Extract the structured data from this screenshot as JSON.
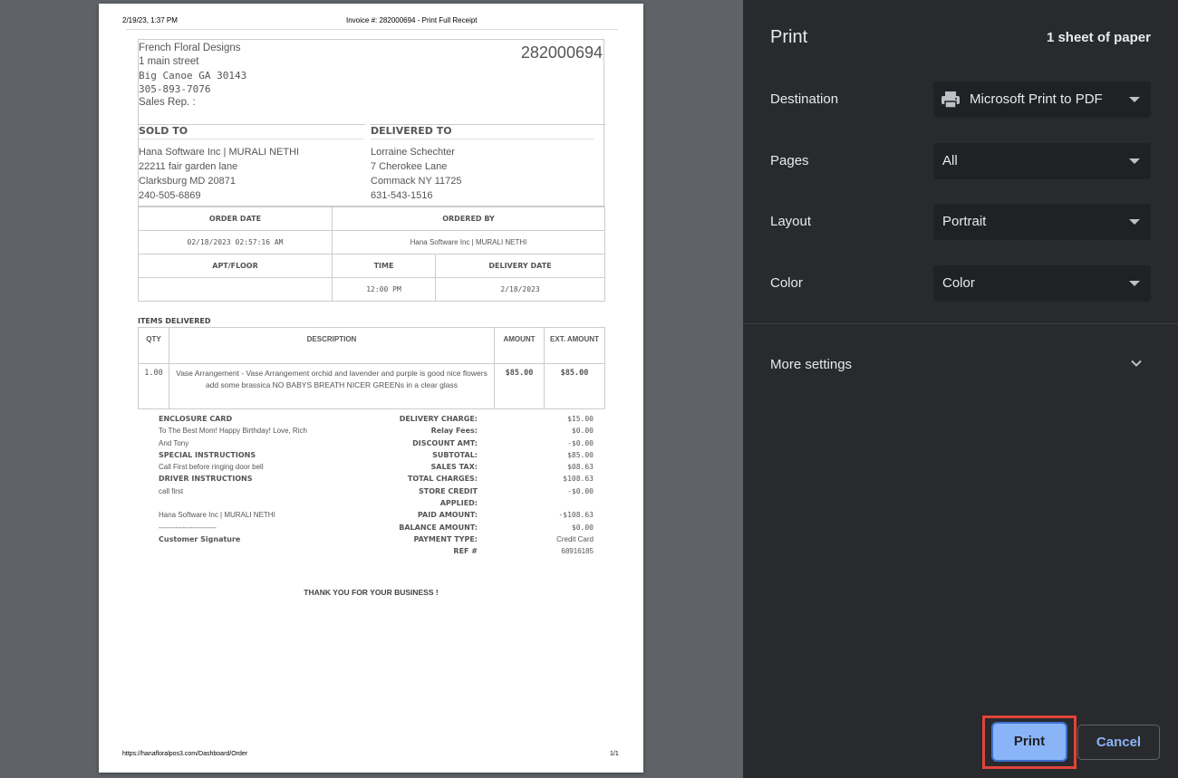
{
  "preview": {
    "header_date": "2/19/23, 1:37 PM",
    "header_title": "Invoice #: 282000694 - Print Full Receipt",
    "footer_url": "https://hanafloralpos3.com/Dashboard/Order",
    "footer_page": "1/1"
  },
  "receipt": {
    "shop_name": "French Floral Designs",
    "shop_street": "1 main street",
    "shop_city": "Big Canoe GA 30143",
    "shop_phone": "305-893-7076",
    "sales_rep": "Sales Rep. :",
    "invoice_number": "282000694",
    "sold_to_label": "SOLD TO",
    "sold_to": [
      "Hana Software Inc | MURALI NETHI",
      "22211 fair garden lane",
      "Clarksburg MD 20871",
      "240-505-6869"
    ],
    "delivered_to_label": "DELIVERED TO",
    "delivered_to": [
      "Lorraine Schechter",
      "7 Cherokee Lane",
      "Commack NY 11725",
      "631-543-1516"
    ],
    "order_date_label": "ORDER DATE",
    "order_date": "02/18/2023 02:57:16 AM",
    "ordered_by_label": "ORDERED BY",
    "ordered_by": "Hana Software Inc | MURALI NETHI",
    "apt_floor_label": "APT/FLOOR",
    "apt_floor": "",
    "time_label": "TIME",
    "time": "12:00 PM",
    "delivery_date_label": "DELIVERY DATE",
    "delivery_date": "2/18/2023",
    "items_title": "ITEMS DELIVERED",
    "items_headers": {
      "qty": "QTY",
      "description": "DESCRIPTION",
      "amount": "AMOUNT",
      "ext_amount": "EXT. AMOUNT"
    },
    "items": [
      {
        "qty": "1.00",
        "description": "Vase Arrangement - Vase Arrangement orchid and lavender and purple is good nice flowers add some brassica NO BABYS BREATH NICER GREENs in a clear glass",
        "amount": "$85.00",
        "ext_amount": "$85.00"
      }
    ],
    "enclosure_card_label": "ENCLOSURE CARD",
    "enclosure_card_line1": "To The Best Mom! Happy Birthday! Love, Rich",
    "enclosure_card_line2": "And Tony",
    "special_instructions_label": "SPECIAL INSTRUCTIONS",
    "special_instructions": "Call First before ringing door bell",
    "driver_instructions_label": "DRIVER INSTRUCTIONS",
    "driver_instructions": "call first",
    "signature_name": "Hana Software Inc | MURALI NETHI",
    "signature_line": "------------------------",
    "signature_label": "Customer Signature",
    "totals_labels": [
      "DELIVERY CHARGE:",
      "Relay Fees:",
      "DISCOUNT AMT:",
      "SUBTOTAL:",
      "SALES TAX:",
      "TOTAL CHARGES:",
      "STORE CREDIT",
      "APPLIED:",
      "PAID AMOUNT:",
      "BALANCE AMOUNT:",
      "PAYMENT TYPE:",
      "REF #"
    ],
    "totals_values": [
      "$15.00",
      "$0.00",
      "-$0.00",
      "$85.00",
      "$08.63",
      "$108.63",
      "-$0.00",
      "",
      "-$108.63",
      "$0.00",
      "Credit Card",
      "68916185"
    ],
    "thanks": "THANK YOU FOR YOUR BUSINESS !"
  },
  "panel": {
    "title": "Print",
    "sheets": "1 sheet of paper",
    "destination_label": "Destination",
    "destination_value": "Microsoft Print to PDF",
    "pages_label": "Pages",
    "pages_value": "All",
    "layout_label": "Layout",
    "layout_value": "Portrait",
    "color_label": "Color",
    "color_value": "Color",
    "more_settings": "More settings",
    "print_button": "Print",
    "cancel_button": "Cancel"
  },
  "colors": {
    "panel_bg": "#292a2d",
    "select_bg": "#202124",
    "accent": "#8ab4f8",
    "highlight": "#e0443a"
  }
}
